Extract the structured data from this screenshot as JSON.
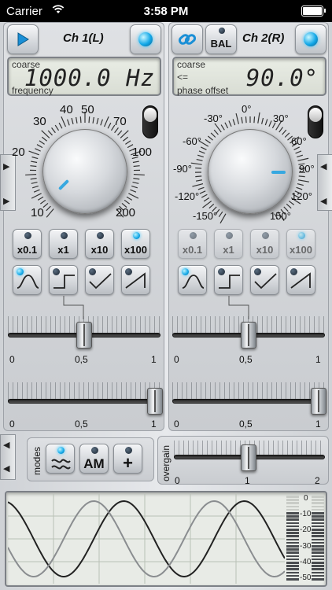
{
  "status": {
    "carrier": "Carrier",
    "time": "3:58 PM"
  },
  "ch1": {
    "title": "Ch 1(L)",
    "lcd": {
      "top": "coarse",
      "value": "1000.0 Hz",
      "bottom": "frequency"
    },
    "dial_labels": [
      "10",
      "20",
      "30",
      "40",
      "50",
      "70",
      "100",
      "200"
    ],
    "range_buttons": [
      "x0.1",
      "x1",
      "x10",
      "x100"
    ],
    "active_range": 3,
    "waveforms": [
      "sine-wave-icon",
      "square-wave-icon",
      "triangle-wave-icon",
      "sawtooth-wave-icon"
    ],
    "slider1": {
      "labels": [
        "0",
        "0,5",
        "1"
      ],
      "value": 0.5
    },
    "slider2": {
      "labels": [
        "0",
        "0,5",
        "1"
      ],
      "value": 1.0
    }
  },
  "ch2": {
    "title": "Ch 2(R)",
    "bal_label": "BAL",
    "lcd": {
      "top": "coarse",
      "arrow": "<=",
      "value": "90.0°",
      "bottom": "phase offset"
    },
    "dial_labels": [
      "0°",
      "30°",
      "60°",
      "90°",
      "120°",
      "150°",
      "-150°",
      "-120°",
      "-90°",
      "-60°",
      "-30°"
    ],
    "range_buttons": [
      "x0.1",
      "x1",
      "x10",
      "x100"
    ],
    "active_range": 3,
    "waveforms": [
      "sine-wave-icon",
      "square-wave-icon",
      "triangle-wave-icon",
      "sawtooth-wave-icon"
    ],
    "slider1": {
      "labels": [
        "0",
        "0,5",
        "1"
      ],
      "value": 0.5
    },
    "slider2": {
      "labels": [
        "0",
        "0,5",
        "1"
      ],
      "value": 1.0
    }
  },
  "modes": {
    "label": "modes",
    "am": "AM",
    "plus": "+"
  },
  "overgain": {
    "label": "overgain",
    "labels": [
      "0",
      "1",
      "2"
    ],
    "value": 1.0
  },
  "meter": {
    "labels": [
      "0",
      "-10",
      "-20",
      "-30",
      "-40",
      "-50"
    ]
  },
  "colors": {
    "accent": "#12a8e8",
    "lcd": "#dfe3da",
    "panel": "#d4d7db"
  }
}
